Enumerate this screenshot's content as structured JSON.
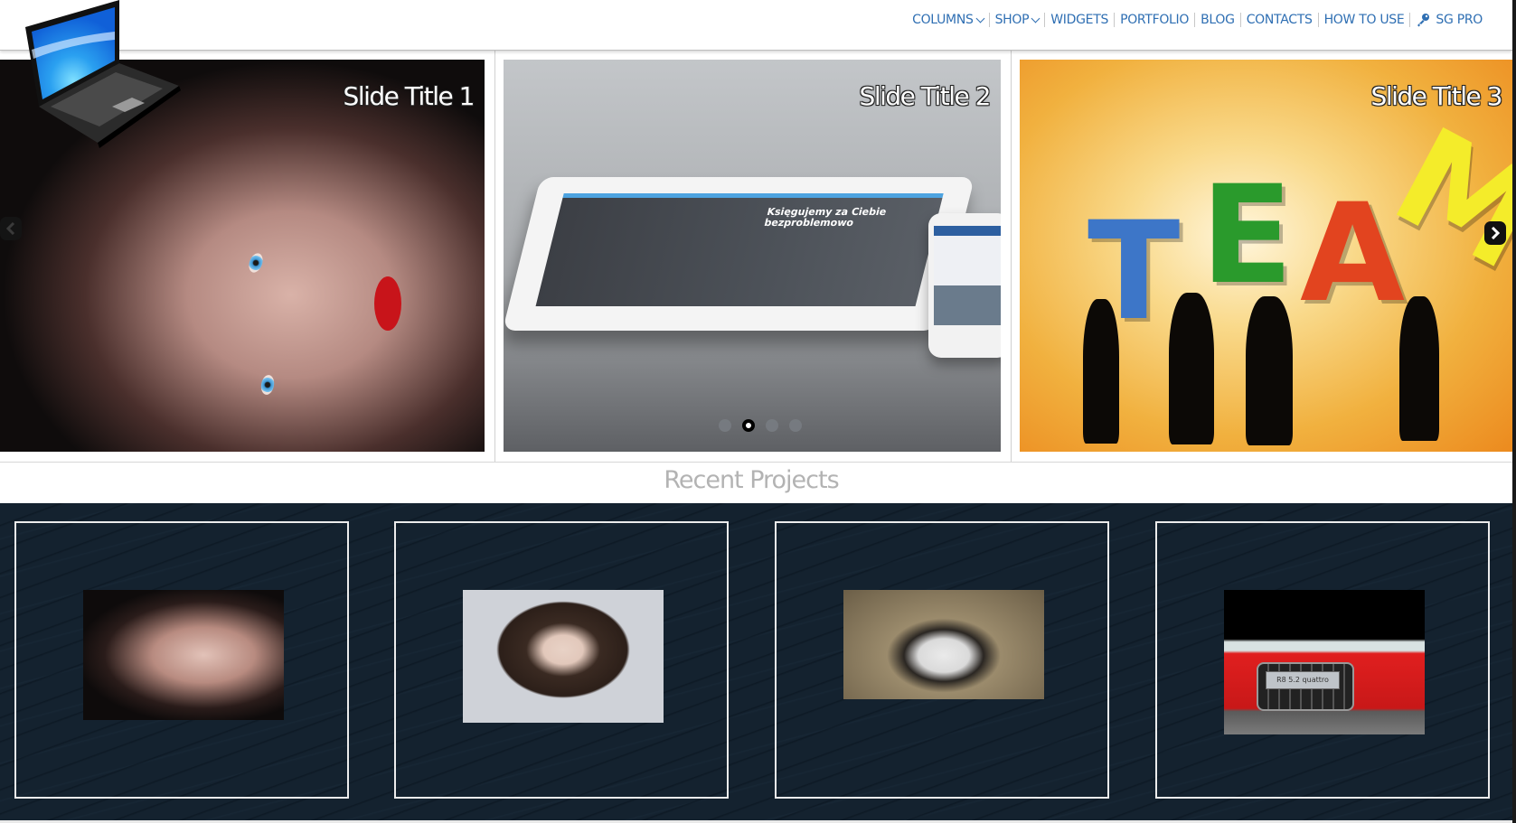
{
  "header": {
    "nav": [
      {
        "label": "COLUMNS",
        "has_dropdown": true
      },
      {
        "label": "SHOP",
        "has_dropdown": true
      },
      {
        "label": "WIDGETS",
        "has_dropdown": false
      },
      {
        "label": "PORTFOLIO",
        "has_dropdown": false
      },
      {
        "label": "BLOG",
        "has_dropdown": false
      },
      {
        "label": "CONTACTS",
        "has_dropdown": false
      },
      {
        "label": "HOW TO USE",
        "has_dropdown": false
      },
      {
        "label": "SG PRO",
        "has_dropdown": false,
        "icon": "key-icon"
      }
    ],
    "link_color": "#2f6fb3",
    "logo_icon": "laptop-icon"
  },
  "slider": {
    "slides": [
      {
        "title": "Slide Title 1",
        "image": "woman-blue-eyes-red-lips"
      },
      {
        "title": "Slide Title 2",
        "image": "tablet-and-phone"
      },
      {
        "title": "Slide Title 3",
        "image": "team-letters-silhouettes"
      }
    ],
    "slide2_screen_text": "Księgujemy za Ciebie bezproblemowo",
    "team_letters": [
      "T",
      "E",
      "A",
      "M"
    ],
    "prev_icon": "chevron-left-icon",
    "next_icon": "chevron-right-icon",
    "dots": 4,
    "active_dot": 2
  },
  "projects": {
    "title": "Recent Projects",
    "items": [
      {
        "image": "woman-red-lips"
      },
      {
        "image": "woman-curly-hair"
      },
      {
        "image": "girl-sunglasses"
      },
      {
        "image": "red-audi-r8",
        "plate_text": "R8 5.2 quattro"
      }
    ]
  }
}
